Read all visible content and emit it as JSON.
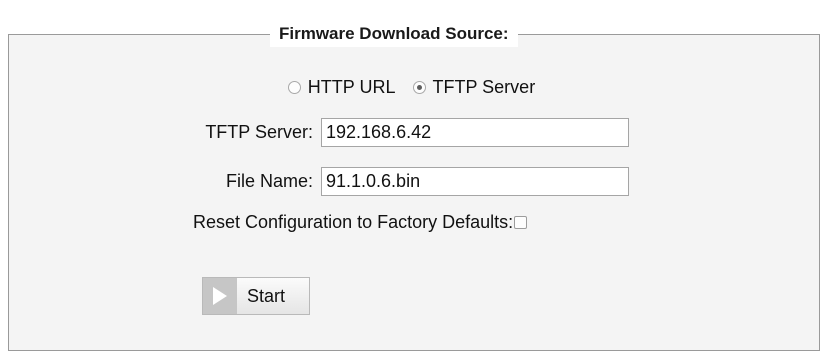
{
  "fieldset": {
    "legend": "Firmware Download Source:"
  },
  "source": {
    "options": [
      {
        "label": "HTTP URL",
        "checked": false
      },
      {
        "label": "TFTP Server",
        "checked": true
      }
    ]
  },
  "tftp_server": {
    "label": "TFTP Server:",
    "value": "192.168.6.42"
  },
  "file_name": {
    "label": "File Name:",
    "value": "91.1.0.6.bin"
  },
  "reset": {
    "label": "Reset Configuration to Factory Defaults:",
    "checked": false
  },
  "start_button": {
    "label": "Start",
    "icon": "play-icon"
  },
  "colors": {
    "panel_background": "#f4f4f4",
    "border": "#9a9a9a",
    "play_icon": "#ffffff",
    "play_box": "#c6c6c6"
  }
}
